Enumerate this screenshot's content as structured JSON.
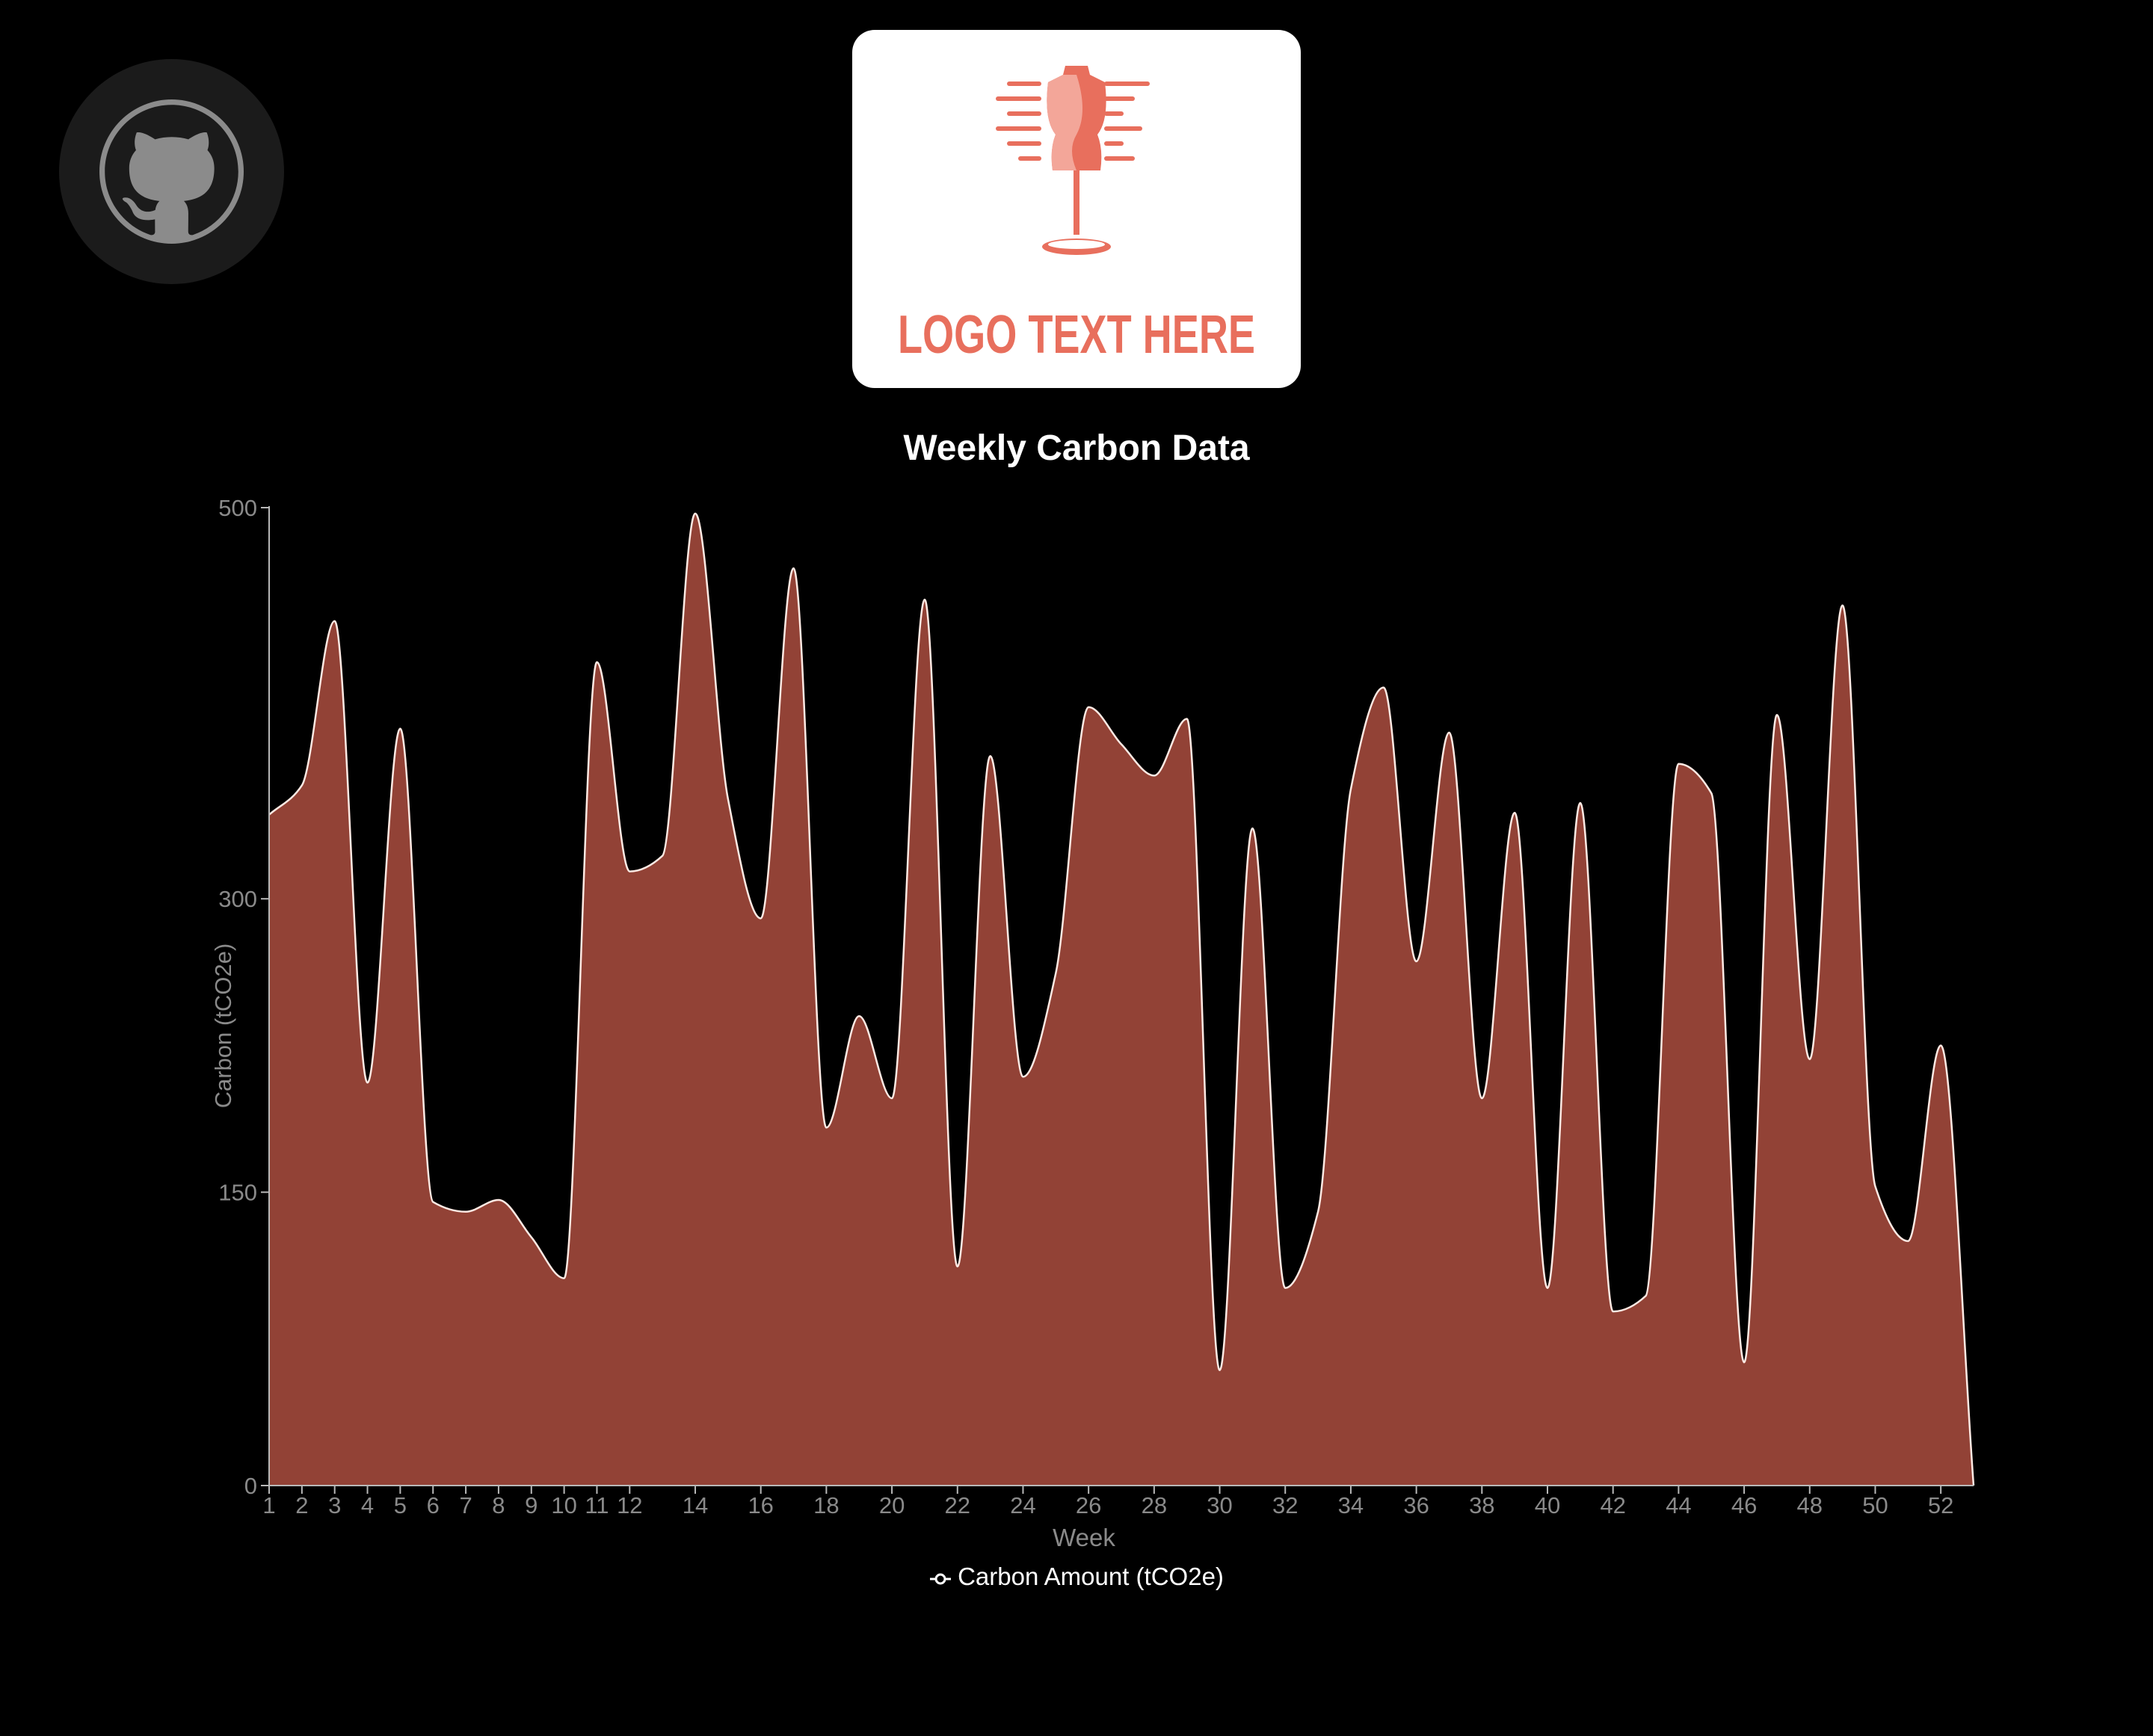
{
  "header": {
    "github_icon": "github-icon",
    "logo_text": "LOGO TEXT HERE",
    "logo_icon": "dress-form-icon"
  },
  "chart_data": {
    "type": "area",
    "title": "Weekly Carbon Data",
    "xlabel": "Week",
    "ylabel": "Carbon (tCO2e)",
    "ylim": [
      0,
      500
    ],
    "yticks": [
      0,
      150,
      300,
      500
    ],
    "xticks": [
      1,
      2,
      3,
      4,
      5,
      6,
      7,
      8,
      9,
      10,
      11,
      12,
      14,
      16,
      18,
      20,
      22,
      24,
      26,
      28,
      30,
      32,
      34,
      36,
      38,
      40,
      42,
      44,
      46,
      48,
      50,
      52
    ],
    "x": [
      1,
      2,
      3,
      4,
      5,
      6,
      7,
      8,
      9,
      10,
      11,
      12,
      13,
      14,
      15,
      16,
      17,
      18,
      19,
      20,
      21,
      22,
      23,
      24,
      25,
      26,
      27,
      28,
      29,
      30,
      31,
      32,
      33,
      34,
      35,
      36,
      37,
      38,
      39,
      40,
      41,
      42,
      43,
      44,
      45,
      46,
      47,
      48,
      49,
      50,
      51,
      52,
      53
    ],
    "values": [
      343,
      358,
      442,
      206,
      387,
      145,
      140,
      146,
      127,
      106,
      421,
      314,
      322,
      497,
      351,
      290,
      469,
      183,
      240,
      198,
      453,
      112,
      373,
      209,
      262,
      398,
      379,
      363,
      392,
      59,
      336,
      101,
      140,
      356,
      408,
      268,
      385,
      198,
      344,
      101,
      349,
      89,
      97,
      369,
      354,
      63,
      394,
      218,
      450,
      153,
      125,
      225,
      0
    ],
    "series": [
      {
        "name": "Carbon Amount (tCO2e)"
      }
    ],
    "colors": {
      "fill": "#924236",
      "line": "#fde9e3",
      "axis": "#b8b8b8",
      "tick_text": "#8a8a8a"
    },
    "legend_position": "bottom-center",
    "grid": false
  }
}
